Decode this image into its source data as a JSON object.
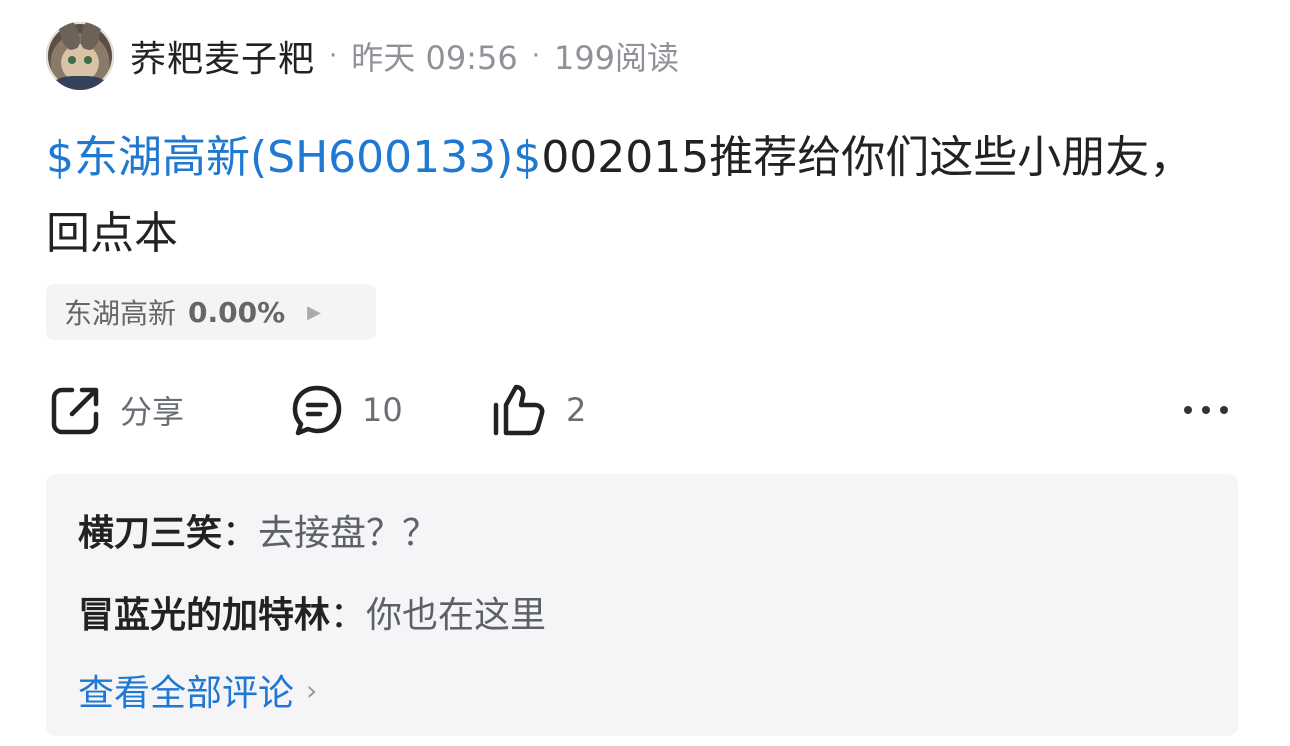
{
  "header": {
    "username": "荞粑麦子粑",
    "time": "昨天 09:56",
    "reads": "199阅读"
  },
  "post": {
    "link_text": "$东湖高新(SH600133)$",
    "body": "002015推荐给你们这些小朋友，回点本"
  },
  "quote_chip": {
    "name": "东湖高新",
    "change": "0.00%"
  },
  "actions": {
    "share_label": "分享",
    "comment_count": "10",
    "like_count": "2"
  },
  "comments": [
    {
      "author": "横刀三笑",
      "text": "去接盘？？"
    },
    {
      "author": "冒蓝光的加特林",
      "text": "你也在这里"
    }
  ],
  "view_all_label": "查看全部评论",
  "colors": {
    "link": "#1f78d1",
    "muted": "#8f9399",
    "panel": "#f5f5f7"
  }
}
